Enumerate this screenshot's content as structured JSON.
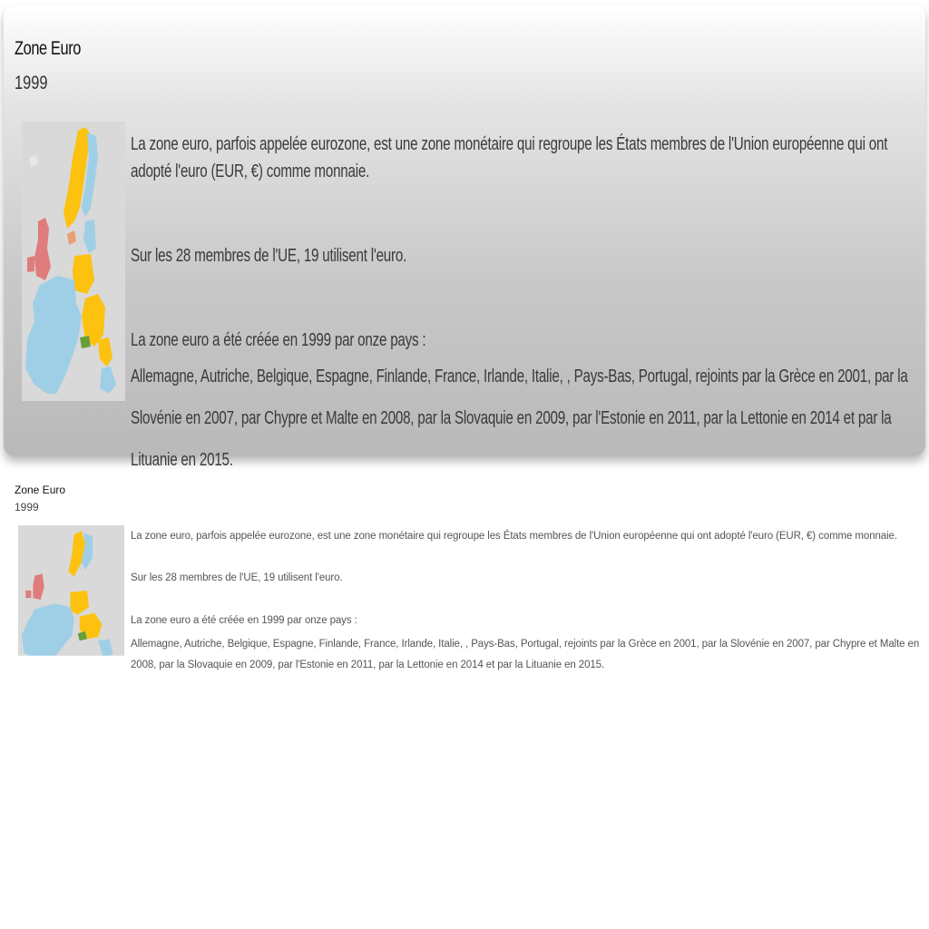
{
  "large_card": {
    "title": "Zone Euro",
    "year": "1999",
    "paragraphs": [
      "La zone euro, parfois appelée eurozone, est une zone monétaire qui regroupe les États membres de l'Union européenne qui ont adopté l'euro (EUR, €) comme monnaie.",
      "Sur les 28 membres de l'UE, 19 utilisent l'euro.",
      "La zone euro a été créée en 1999 par onze pays :",
      "Allemagne, Autriche, Belgique, Espagne, Finlande, France, Irlande, Italie, , Pays-Bas, Portugal, rejoints par la Grèce en 2001, par la Slovénie en 2007, par Chypre et Malte en 2008, par la Slovaquie en 2009, par l'Estonie en 2011, par la Lettonie en 2014 et par la Lituanie en 2015."
    ]
  },
  "small_card": {
    "title": "Zone Euro",
    "year": "1999",
    "paragraphs": [
      "La zone euro, parfois appelée eurozone, est une zone monétaire qui regroupe les États membres de l'Union européenne qui ont adopté l'euro (EUR, €) comme monnaie.",
      "Sur les 28 membres de l'UE, 19 utilisent l'euro.",
      "La zone euro a été créée en 1999 par onze pays :",
      "Allemagne, Autriche, Belgique, Espagne, Finlande, France, Irlande, Italie, , Pays-Bas, Portugal, rejoints par la Grèce en 2001, par la Slovénie en 2007, par Chypre et Malte en 2008, par la Slovaquie en 2009, par l'Estonie en 2011, par la Lettonie en 2014 et par la Lituanie en 2015."
    ]
  },
  "map_colors": {
    "background": "#d9d9d9",
    "eurozone": "#9fcfe6",
    "non_euro_member": "#fcc20f",
    "uk": "#e07c7c",
    "other": "#6a9e3c"
  }
}
